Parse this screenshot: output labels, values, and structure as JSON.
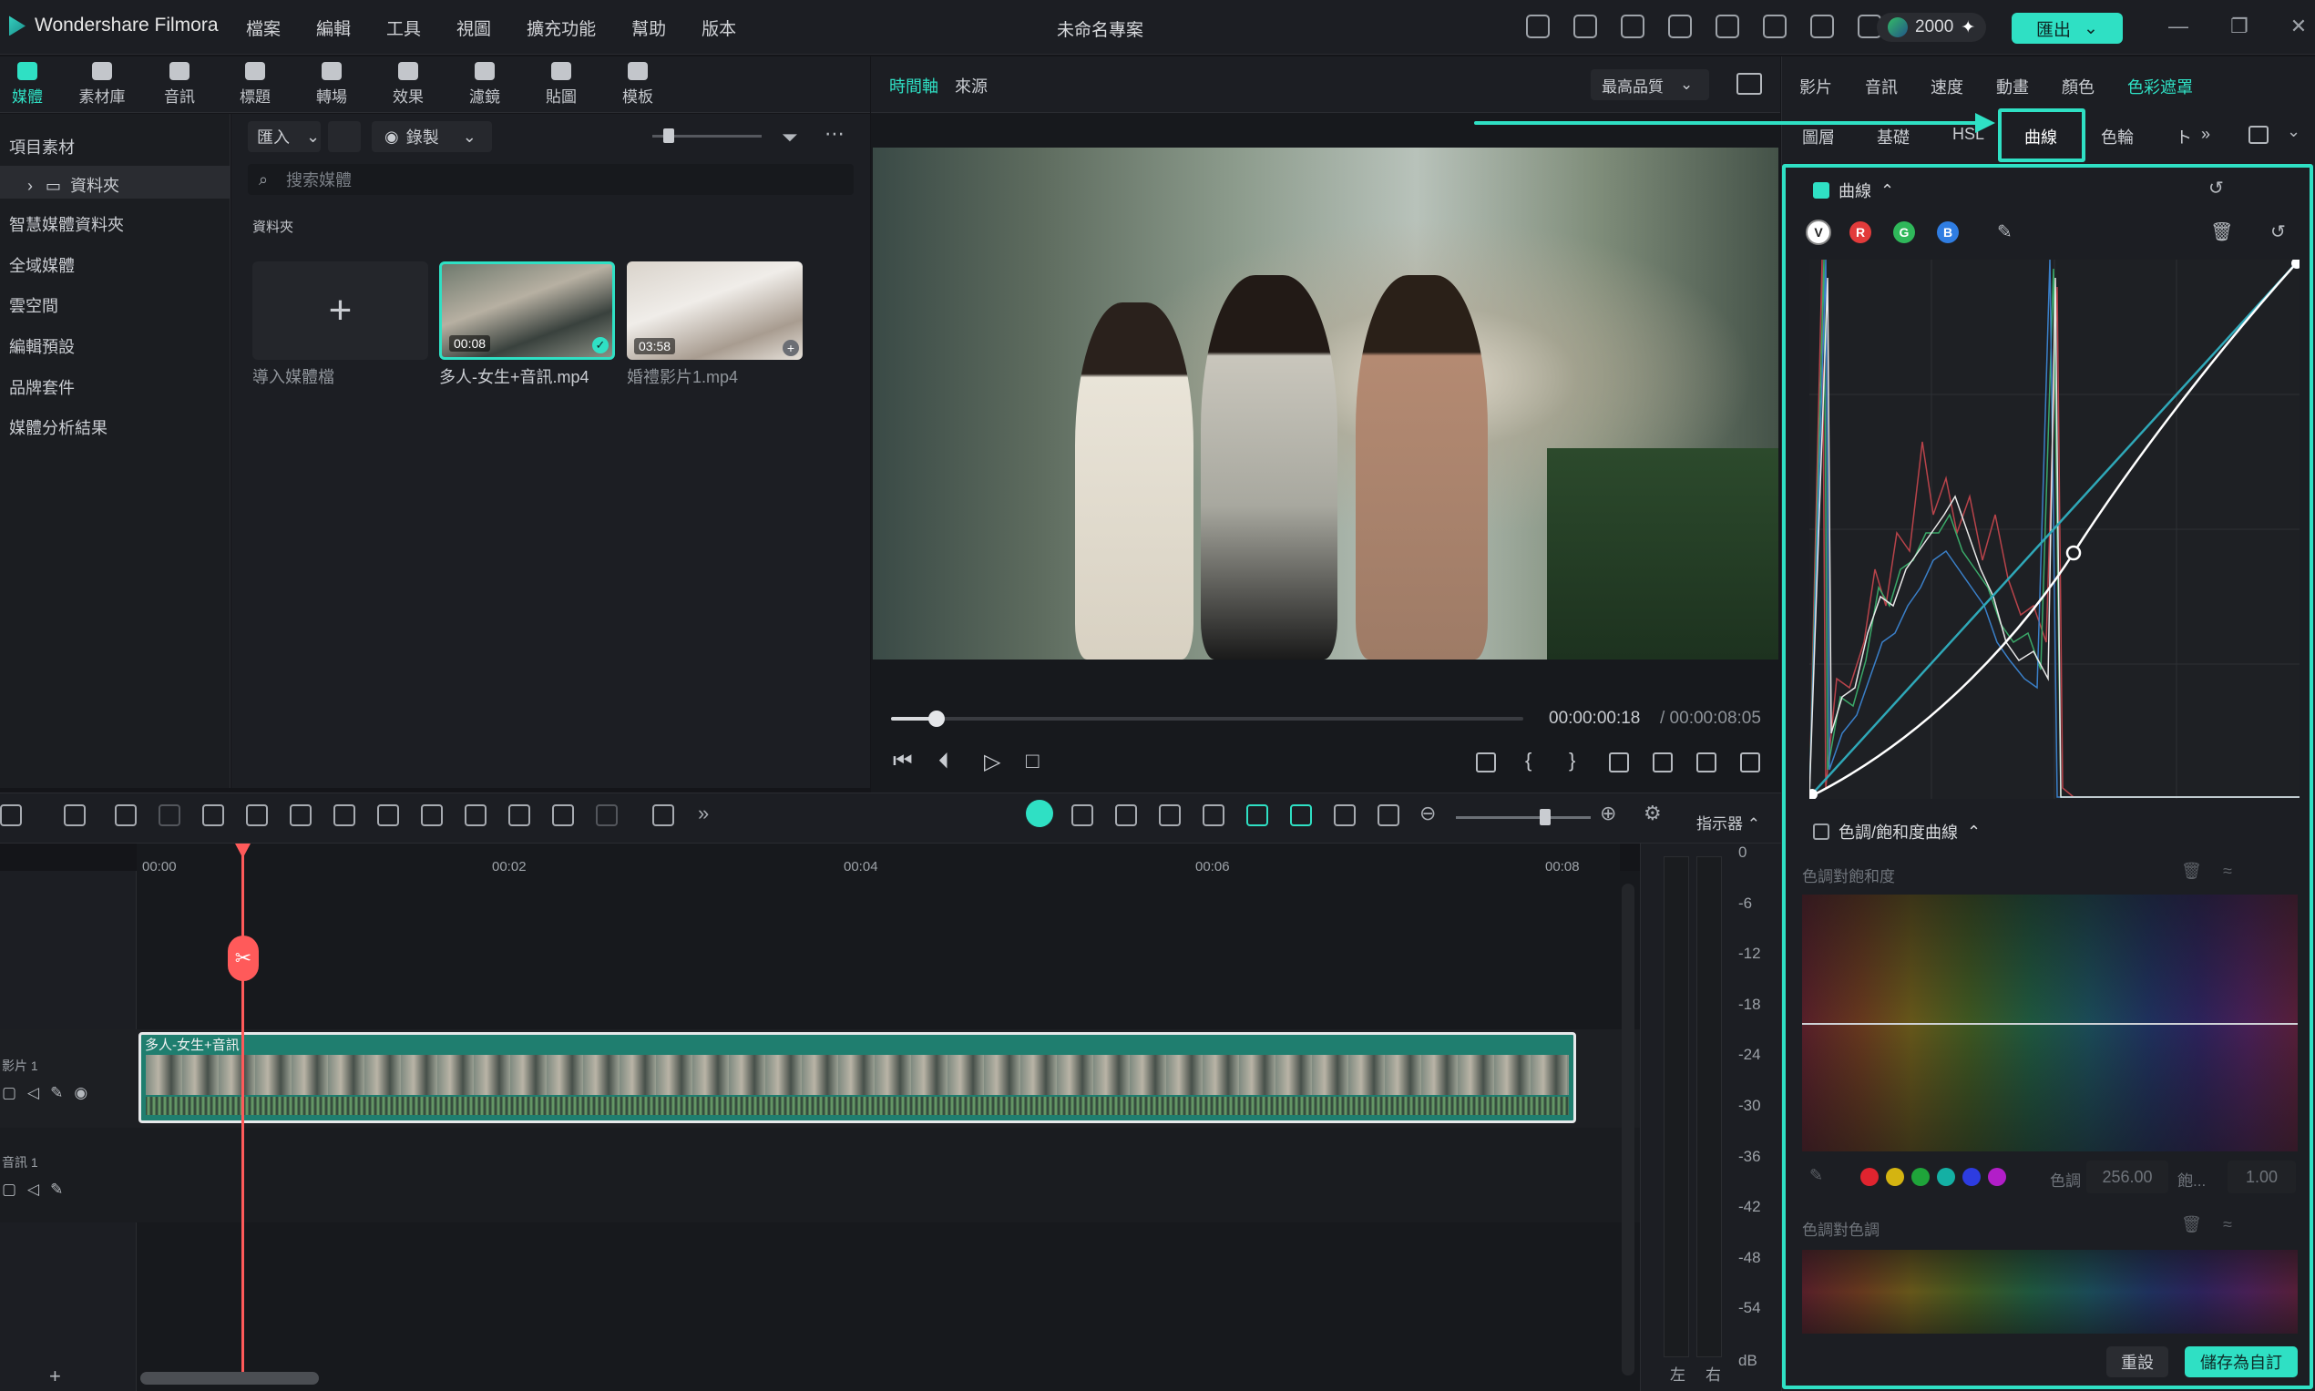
{
  "app": {
    "name": "Wondershare Filmora",
    "project_title": "未命名專案",
    "credits": "2000",
    "export_label": "匯出"
  },
  "menu": [
    "檔案",
    "編輯",
    "工具",
    "視圖",
    "擴充功能",
    "幫助",
    "版本"
  ],
  "media_tabs": [
    "媒體",
    "素材庫",
    "音訊",
    "標題",
    "轉場",
    "效果",
    "濾鏡",
    "貼圖",
    "模板"
  ],
  "sidebar": [
    "項目素材",
    "資料夾",
    "智慧媒體資料夾",
    "全域媒體",
    "雲空間",
    "編輯預設",
    "品牌套件",
    "媒體分析結果"
  ],
  "media": {
    "import_label": "匯入",
    "record_label": "錄製",
    "search_placeholder": "搜索媒體",
    "folder_label": "資料夾",
    "import_tile_caption": "導入媒體檔",
    "items": [
      {
        "name": "多人-女生+音訊.mp4",
        "duration": "00:08"
      },
      {
        "name": "婚禮影片1.mp4",
        "duration": "03:58"
      }
    ]
  },
  "preview": {
    "tab_timeline": "時間軸",
    "tab_source": "來源",
    "quality": "最高品質",
    "current_time": "00:00:00:18",
    "total_time": "/ 00:00:08:05",
    "progress": 0.072
  },
  "right_panel": {
    "tabs_top": [
      "影片",
      "音訊",
      "速度",
      "動畫",
      "顏色",
      "色彩遮罩"
    ],
    "active_top": "色彩遮罩",
    "tabs_sub": [
      "圖層",
      "基礎",
      "HSL",
      "曲線",
      "色輪",
      "ト",
      "»"
    ],
    "active_sub": "曲線",
    "curves_title": "曲線",
    "channels": [
      "V",
      "R",
      "G",
      "B"
    ],
    "hs_curve_title": "色調/飽和度曲線",
    "hs_label": "色調對飽和度",
    "hh_label": "色調對色調",
    "hue_label": "色調",
    "hue_value": "256.00",
    "sat_label": "飽...",
    "sat_value": "1.00",
    "reset_label": "重設",
    "save_label": "儲存為自訂"
  },
  "timeline": {
    "ruler": [
      "00:00",
      "00:02",
      "00:04",
      "00:06",
      "00:08"
    ],
    "clip_label": "多人-女生+音訊",
    "video_track": "影片 1",
    "audio_track": "音訊 1",
    "meter_label": "指示器",
    "db_scale": [
      "0",
      "-6",
      "-12",
      "-18",
      "-24",
      "-30",
      "-36",
      "-42",
      "-48",
      "-54",
      "dB"
    ],
    "meter_lr": [
      "左",
      "右"
    ]
  },
  "colors": {
    "accent": "#2fe0c4",
    "playhead": "#ff5a5a",
    "red": "#e23b3b",
    "green": "#2fb85a",
    "blue": "#2f7de2"
  }
}
